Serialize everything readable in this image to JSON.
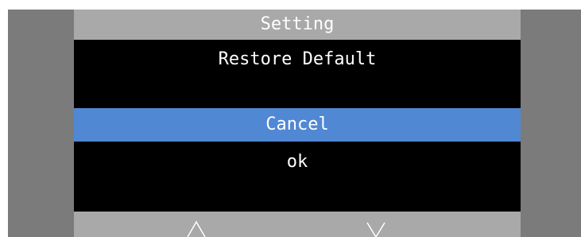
{
  "header": {
    "title": "Setting"
  },
  "dialog": {
    "title": "Restore Default",
    "options": [
      {
        "label": "Cancel",
        "selected": true
      },
      {
        "label": "ok",
        "selected": false
      }
    ]
  },
  "footer": {
    "buttons": [
      {
        "icon": "chevron-up-icon"
      },
      {
        "icon": "chevron-down-icon"
      }
    ]
  },
  "colors": {
    "frame": "#7b7b7b",
    "bar": "#a9a9a9",
    "screen": "#000000",
    "selected": "#5088d4",
    "text": "#ffffff"
  }
}
